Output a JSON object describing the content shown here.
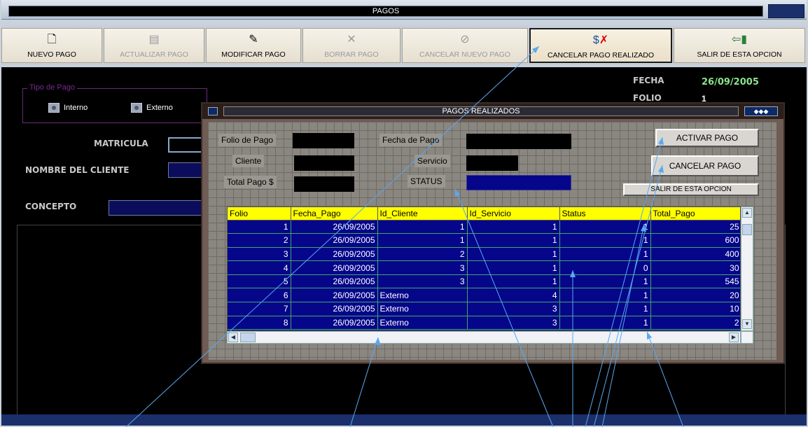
{
  "window": {
    "title": "PAGOS"
  },
  "toolbar": {
    "items": [
      {
        "label": "NUEVO PAGO",
        "icon": "new-document-icon",
        "enabled": true
      },
      {
        "label": "ACTUALIZAR PAGO",
        "icon": "save-icon",
        "enabled": false
      },
      {
        "label": "MODIFICAR PAGO",
        "icon": "edit-icon",
        "enabled": true
      },
      {
        "label": "BORRAR PAGO",
        "icon": "delete-icon",
        "enabled": false
      },
      {
        "label": "CANCELAR NUEVO PAGO",
        "icon": "cancel-icon",
        "enabled": false
      },
      {
        "label": "CANCELAR PAGO REALIZADO",
        "icon": "cancel-payment-icon",
        "enabled": true
      },
      {
        "label": "SALIR DE ESTA OPCION",
        "icon": "exit-door-icon",
        "enabled": true
      }
    ]
  },
  "form": {
    "tipo_pago": {
      "legend": "Tipo de Pago",
      "interno": "Interno",
      "externo": "Externo"
    },
    "matricula_label": "MATRICULA",
    "nombre_label": "NOMBRE DEL CLIENTE",
    "concepto_label": "CONCEPTO",
    "fecha_label": "FECHA",
    "fecha_value": "26/09/2005",
    "folio_label": "FOLIO",
    "folio_value": "1"
  },
  "dialog": {
    "title": "PAGOS REALIZADOS",
    "labels": {
      "folio": "Folio de Pago",
      "cliente": "Cliente",
      "total": "Total Pago  $",
      "fecha": "Fecha de Pago",
      "servicio": "Servicio",
      "status": "STATUS"
    },
    "buttons": {
      "activar": "ACTIVAR PAGO",
      "cancelar": "CANCELAR PAGO",
      "salir": "SALIR DE ESTA OPCION"
    },
    "grid": {
      "columns": [
        "Folio",
        "Fecha_Pago",
        "Id_Cliente",
        "Id_Servicio",
        "Status",
        "Total_Pago"
      ],
      "rows": [
        [
          "1",
          "26/09/2005",
          "1",
          "1",
          "1",
          "25"
        ],
        [
          "2",
          "26/09/2005",
          "1",
          "1",
          "1",
          "600"
        ],
        [
          "3",
          "26/09/2005",
          "2",
          "1",
          "1",
          "400"
        ],
        [
          "4",
          "26/09/2005",
          "3",
          "1",
          "0",
          "30"
        ],
        [
          "5",
          "26/09/2005",
          "3",
          "1",
          "1",
          "545"
        ],
        [
          "6",
          "26/09/2005",
          "Externo",
          "4",
          "1",
          "20"
        ],
        [
          "7",
          "26/09/2005",
          "Externo",
          "3",
          "1",
          "10"
        ],
        [
          "8",
          "26/09/2005",
          "Externo",
          "3",
          "1",
          "2"
        ]
      ]
    }
  }
}
